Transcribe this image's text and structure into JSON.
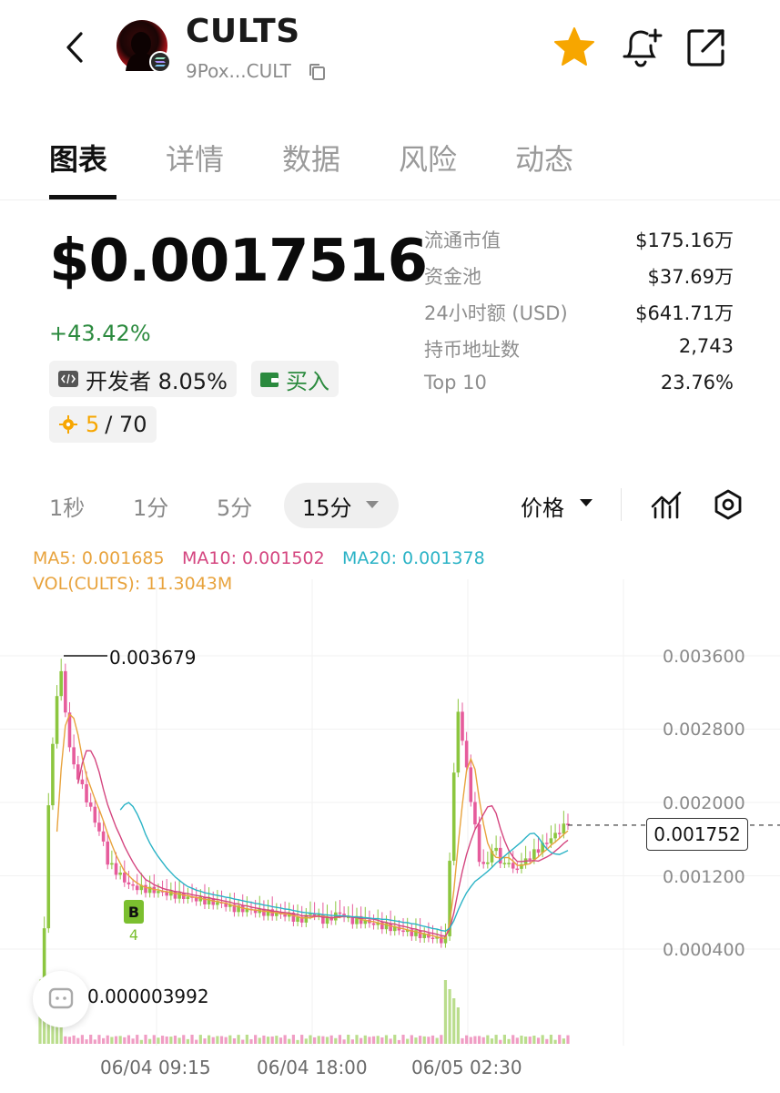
{
  "header": {
    "token_name": "CULTS",
    "address": "9Pox...CULT"
  },
  "tabs": [
    "图表",
    "详情",
    "数据",
    "风险",
    "动态"
  ],
  "price": {
    "value": "$0.0017516",
    "change": "+43.42%",
    "dev_chip": "开发者 8.05%",
    "buy_chip": "买入",
    "score_value": "5",
    "score_total": "/ 70"
  },
  "stats": [
    {
      "label": "流通市值",
      "value": "$175.16万"
    },
    {
      "label": "资金池",
      "value": "$37.69万"
    },
    {
      "label": "24小时额 (USD)",
      "value": "$641.71万"
    },
    {
      "label": "持币地址数",
      "value": "2,743"
    },
    {
      "label": "Top 10",
      "value": "23.76%"
    }
  ],
  "intervals": [
    "1秒",
    "1分",
    "5分",
    "15分"
  ],
  "price_mode": "价格",
  "chart": {
    "ma5": "MA5: 0.001685",
    "ma10": "MA10: 0.001502",
    "ma20": "MA20: 0.001378",
    "vol": "VOL(CULTS): 11.3043M",
    "y_ticks": [
      "0.003600",
      "0.002800",
      "0.002000",
      "0.001200",
      "0.000400"
    ],
    "high_label": "0.003679",
    "low_label": "0.000003992",
    "last_price": "0.001752",
    "x_ticks": [
      "06/04 09:15",
      "06/04 18:00",
      "06/05 02:30"
    ],
    "marker_buy": "B",
    "marker_count": "4",
    "colors": {
      "up": "#8cc63f",
      "down": "#e65c9c",
      "ma5": "#e8a33d",
      "ma10": "#d4457f",
      "ma20": "#2bb3c6"
    }
  },
  "chart_data": {
    "type": "candlestick",
    "interval": "15分",
    "ylim": [
      0.0,
      0.004
    ],
    "y_ticks": [
      0.0036,
      0.0028,
      0.002,
      0.0012,
      0.0004
    ],
    "x_tick_labels": [
      "06/04 09:15",
      "06/04 18:00",
      "06/05 02:30"
    ],
    "high": 0.003679,
    "low": 3.992e-06,
    "last": 0.001752,
    "ma5": 0.001685,
    "ma10": 0.001502,
    "ma20": 0.001378,
    "volume": "11.3043M"
  }
}
